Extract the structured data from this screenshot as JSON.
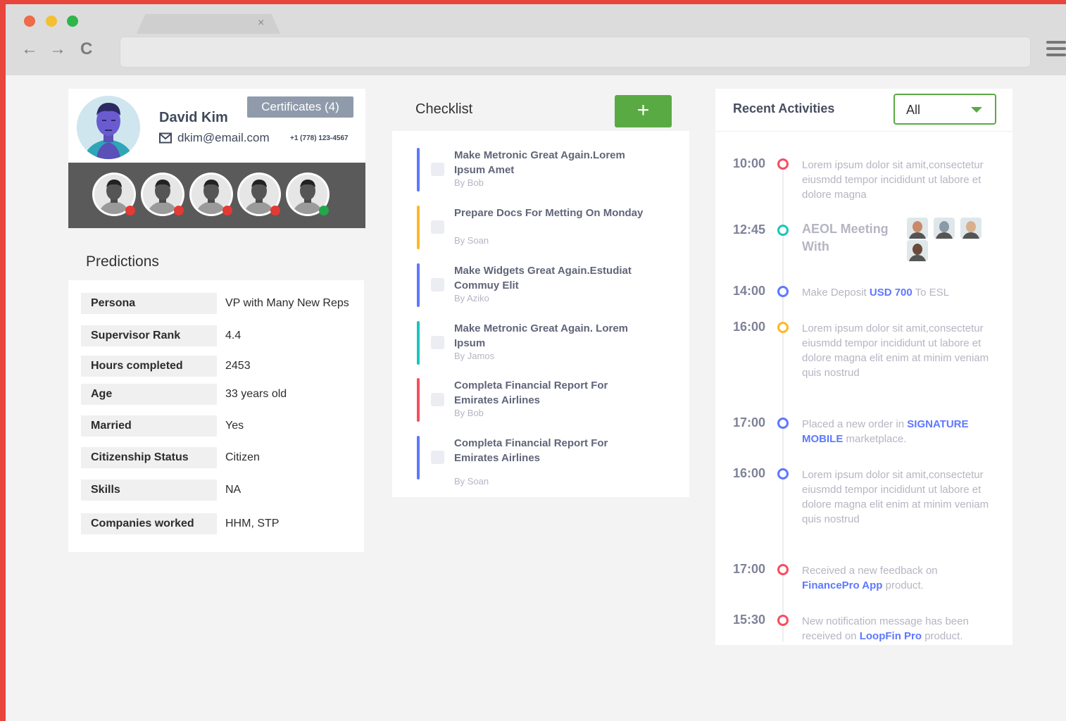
{
  "colors": {
    "accent_green": "#5aaa43",
    "status_red": "#e53935",
    "status_green": "#22a84a",
    "bar_blue": "#5d78ff",
    "bar_yellow": "#ffb822",
    "bar_green": "#1bc5bd",
    "bar_pink": "#f64e60",
    "link_blue": "#5d78ff"
  },
  "browser": {
    "tab_close": "×",
    "back": "←",
    "forward": "→",
    "reload": "C"
  },
  "profile": {
    "name": "David Kim",
    "email": "dkim@email.com",
    "phone": "+1 (778) 123-4567",
    "certificates_label": "Certificates (4)",
    "team": [
      {
        "status": "red"
      },
      {
        "status": "red"
      },
      {
        "status": "red"
      },
      {
        "status": "red"
      },
      {
        "status": "green"
      }
    ]
  },
  "predictions": {
    "title": "Predictions",
    "rows": [
      {
        "label": "Persona",
        "value": "VP with Many New Reps"
      },
      {
        "label": "Supervisor Rank",
        "value": "4.4"
      },
      {
        "label": "Hours completed",
        "value": "2453"
      },
      {
        "label": "Age",
        "value": "33 years old"
      },
      {
        "label": "Married",
        "value": "Yes"
      },
      {
        "label": "Citizenship Status",
        "value": "Citizen"
      },
      {
        "label": "Skills",
        "value": "NA"
      },
      {
        "label": "Companies worked",
        "value": "HHM,  STP"
      }
    ]
  },
  "checklist": {
    "title": "Checklist",
    "add_label": "+",
    "items": [
      {
        "title": "Make Metronic Great Again.Lorem Ipsum Amet",
        "by": "By Bob",
        "color": "#5d78ff"
      },
      {
        "title": "Prepare Docs For Metting On Monday",
        "by": "By Soan",
        "color": "#ffb822"
      },
      {
        "title": "Make Widgets Great Again.Estudiat Commuy Elit",
        "by": "By Aziko",
        "color": "#5d78ff"
      },
      {
        "title": "Make Metronic Great Again. Lorem Ipsum",
        "by": "By Jamos",
        "color": "#1bc5bd"
      },
      {
        "title": "Completa Financial Report For Emirates Airlines",
        "by": "By Bob",
        "color": "#f64e60"
      },
      {
        "title": "Completa Financial Report For Emirates Airlines",
        "by": "By Soan",
        "color": "#5d78ff"
      }
    ]
  },
  "activities": {
    "title": "Recent Activities",
    "filter_value": "All",
    "items": [
      {
        "time": "10:00",
        "badge": "#f64e60",
        "text": "Lorem ipsum dolor sit amit,consectetur eiusmdd tempor incididunt ut labore et dolore magna"
      },
      {
        "time": "12:45",
        "badge": "#1bc5bd",
        "title_lines": [
          "AEOL Meeting",
          "With"
        ]
      },
      {
        "time": "14:00",
        "badge": "#5d78ff",
        "pre": "Make Deposit ",
        "link": "USD 700",
        "post": " To ESL"
      },
      {
        "time": "16:00",
        "badge": "#ffb822",
        "text": "Lorem ipsum dolor sit amit,consectetur eiusmdd tempor incididunt ut labore et dolore magna elit enim at minim veniam quis nostrud"
      },
      {
        "time": "17:00",
        "badge": "#5d78ff",
        "pre": "Placed a new order in ",
        "link": "SIGNATURE MOBILE",
        "post": " marketplace."
      },
      {
        "time": "16:00",
        "badge": "#5d78ff",
        "text": "Lorem ipsum dolor sit amit,consectetur eiusmdd tempor incididunt ut labore et dolore magna elit enim at minim veniam quis nostrud"
      },
      {
        "time": "17:00",
        "badge": "#f64e60",
        "pre": "Received a new feedback on ",
        "link": "FinancePro App",
        "post": " product."
      },
      {
        "time": "15:30",
        "badge": "#f64e60",
        "pre": "New notification message has been received on ",
        "link": "LoopFin Pro",
        "post": " product."
      }
    ]
  }
}
